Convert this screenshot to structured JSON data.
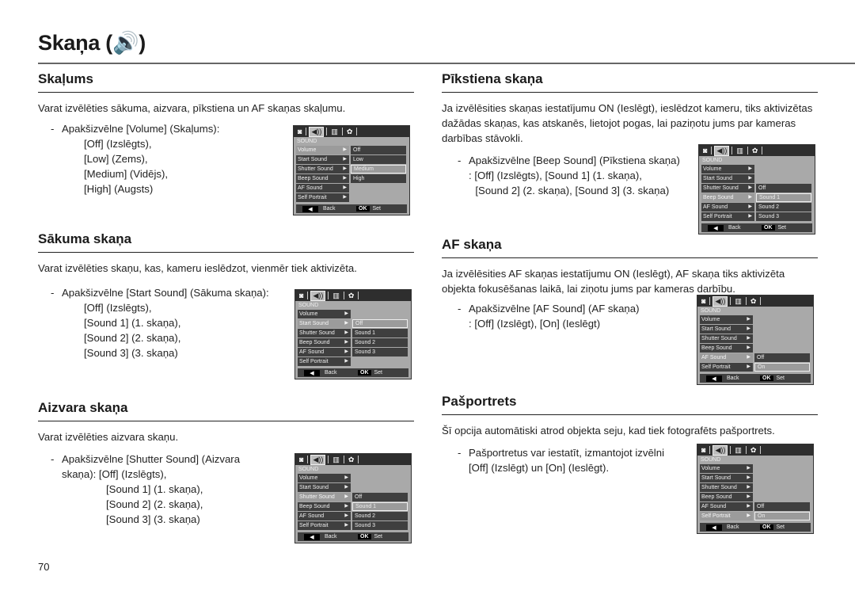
{
  "page": {
    "title": "Skaņa (🔊)",
    "page_number": "70"
  },
  "lcd_common": {
    "tabs": [
      "camera-icon",
      "sound-icon",
      "display-icon",
      "settings-icon"
    ],
    "tab_glyphs": [
      "◙",
      "◀))",
      "▥",
      "✿"
    ],
    "header": "SOUND",
    "menu": [
      "Volume",
      "Start Sound",
      "Shutter Sound",
      "Beep Sound",
      "AF Sound",
      "Self Portrait"
    ],
    "back_key": "◀",
    "back_label": "Back",
    "ok_key": "OK",
    "set_label": "Set"
  },
  "sections": {
    "volume": {
      "heading": "Skaļums",
      "description": "Varat izvēlēties sākuma, aizvara, pīkstiena un AF skaņas skaļumu.",
      "bullet": [
        "Apakšizvēlne [Volume] (Skaļums):",
        "[Off] (Izslēgts),",
        "[Low] (Zems),",
        "[Medium] (Vidējs),",
        "[High] (Augsts)"
      ],
      "lcd": {
        "selected_menu": "Volume",
        "options": [
          "Off",
          "Low",
          "Medium",
          "High"
        ],
        "selected_option": "Medium"
      }
    },
    "start_sound": {
      "heading": "Sākuma skaņa",
      "description": "Varat izvēlēties skaņu, kas, kameru ieslēdzot, vienmēr tiek aktivizēta.",
      "bullet": [
        "Apakšizvēlne [Start Sound] (Sākuma skaņa):",
        "[Off] (Izslēgts),",
        "[Sound 1] (1. skaņa),",
        "[Sound 2] (2. skaņa),",
        "[Sound 3] (3. skaņa)"
      ],
      "lcd": {
        "selected_menu": "Start Sound",
        "options": [
          "Off",
          "Sound 1",
          "Sound 2",
          "Sound 3"
        ],
        "selected_option": "Off"
      }
    },
    "shutter_sound": {
      "heading": "Aizvara skaņa",
      "description": "Varat izvēlēties aizvara skaņu.",
      "bullet": [
        "Apakšizvēlne [Shutter Sound] (Aizvara",
        "skaņa): [Off] (Izslēgts),",
        "[Sound 1] (1. skaņa),",
        "[Sound 2] (2. skaņa),",
        "[Sound 3] (3. skaņa)"
      ],
      "lcd": {
        "selected_menu": "Shutter Sound",
        "options": [
          "Off",
          "Sound 1",
          "Sound 2",
          "Sound 3"
        ],
        "selected_option": "Sound 1"
      }
    },
    "beep_sound": {
      "heading": "Pīkstiena skaņa",
      "description": "Ja izvēlēsities skaņas iestatījumu ON (Ieslēgt), ieslēdzot kameru, tiks aktivizētas dažādas skaņas, kas atskanēs, lietojot pogas, lai paziņotu jums par kameras darbības stāvokli.",
      "bullet": [
        "Apakšizvēlne [Beep Sound] (Pīkstiena skaņa)",
        ": [Off] (Izslēgts), [Sound 1] (1. skaņa),",
        "[Sound 2] (2. skaņa), [Sound 3] (3. skaņa)"
      ],
      "lcd": {
        "selected_menu": "Beep Sound",
        "options": [
          "Off",
          "Sound 1",
          "Sound 2",
          "Sound 3"
        ],
        "selected_option": "Sound 1"
      }
    },
    "af_sound": {
      "heading": "AF skaņa",
      "description": "Ja izvēlēsities AF skaņas iestatījumu ON (Ieslēgt), AF skaņa tiks aktivizēta objekta fokusēšanas laikā, lai ziņotu jums par kameras darbību.",
      "bullet": [
        "Apakšizvēlne [AF Sound] (AF skaņa)",
        ": [Off] (Izslēgt), [On] (Ieslēgt)"
      ],
      "lcd": {
        "selected_menu": "AF Sound",
        "options": [
          "Off",
          "On"
        ],
        "selected_option": "On"
      }
    },
    "self_portrait": {
      "heading": "Pašportrets",
      "description": "Šī opcija automātiski atrod objekta seju, kad tiek fotografēts pašportrets.",
      "bullet": [
        "Pašportretus var iestatīt, izmantojot izvēlni",
        "[Off] (Izslēgt) un [On] (Ieslēgt)."
      ],
      "lcd": {
        "selected_menu": "Self Portrait",
        "options": [
          "Off",
          "On"
        ],
        "selected_option": "On"
      }
    }
  }
}
